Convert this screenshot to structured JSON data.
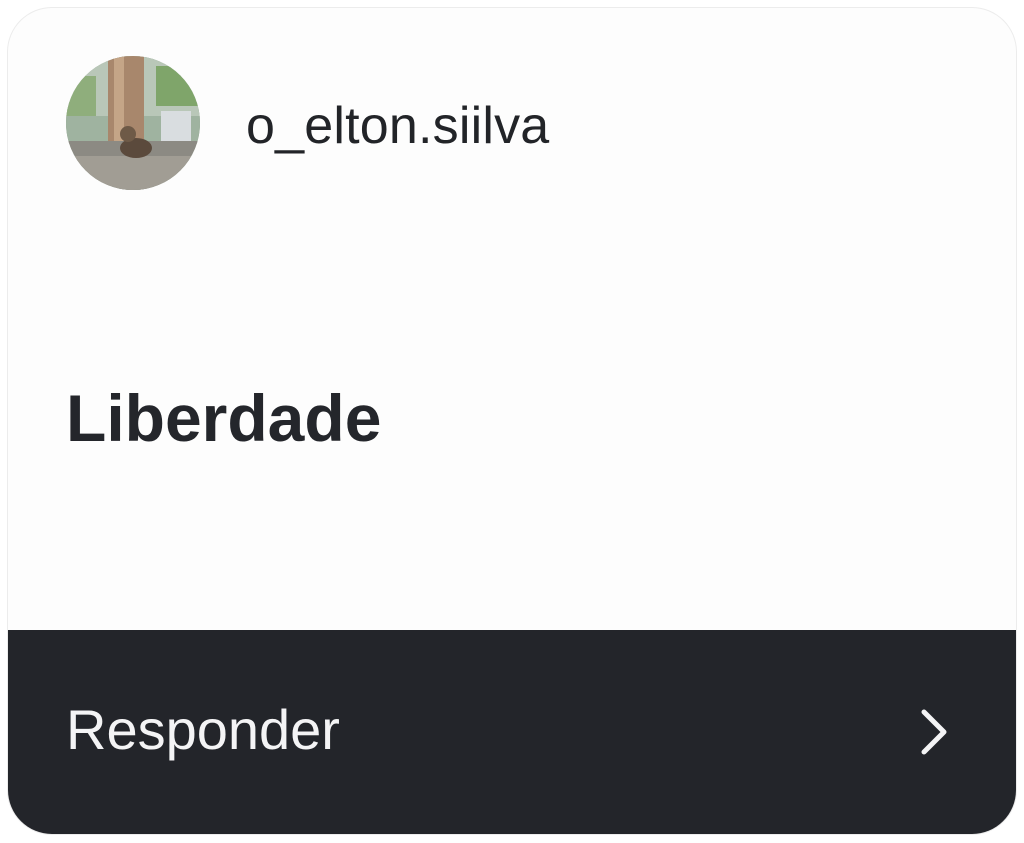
{
  "story_reply_card": {
    "username": "o_elton.siilva",
    "message": "Liberdade",
    "reply_label": "Responder",
    "avatar_icon": "profile-photo",
    "chevron_icon": "chevron-right-icon"
  },
  "colors": {
    "card_background": "#fdfdfd",
    "footer_background": "#23252a",
    "text_primary": "#222428",
    "footer_text": "#f4f4f5"
  }
}
